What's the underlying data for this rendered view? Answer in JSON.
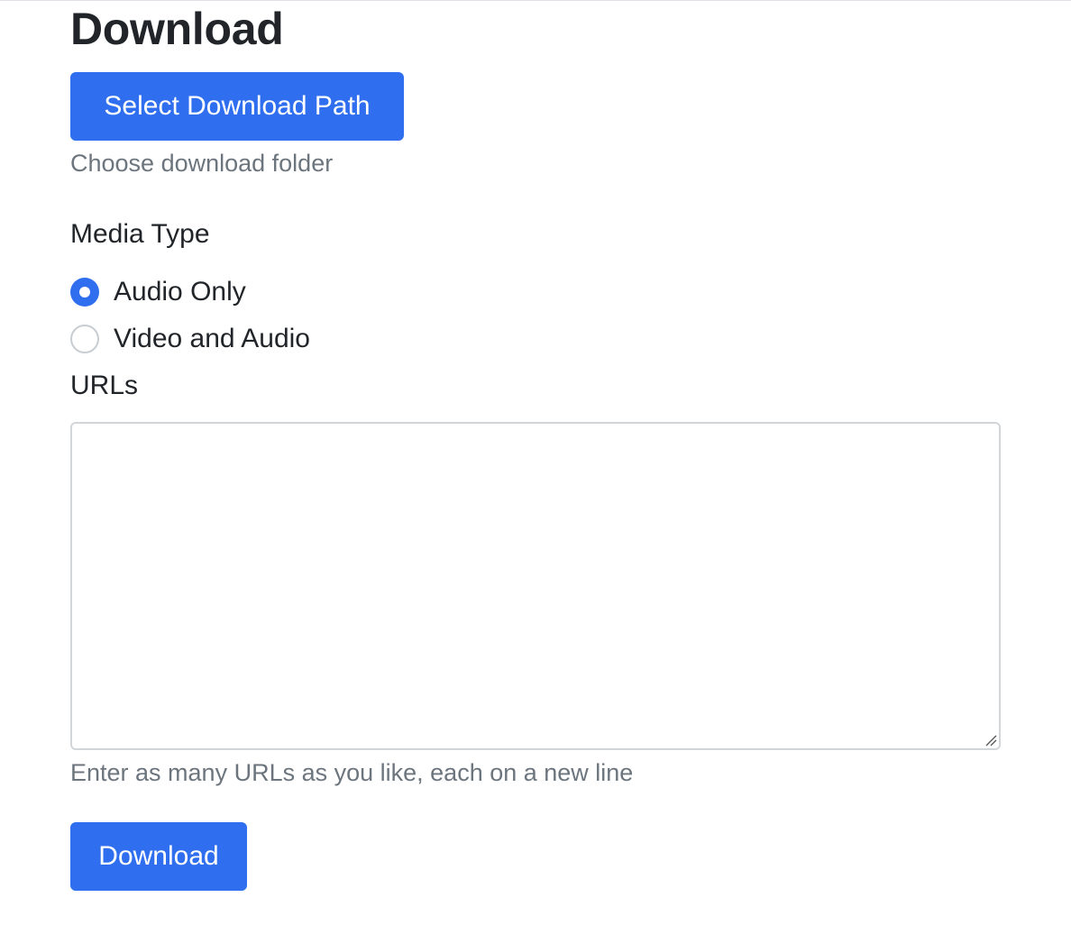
{
  "heading": "Download",
  "path_section": {
    "button_label": "Select Download Path",
    "help_text": "Choose download folder"
  },
  "media_type": {
    "label": "Media Type",
    "options": [
      {
        "label": "Audio Only",
        "checked": true
      },
      {
        "label": "Video and Audio",
        "checked": false
      }
    ]
  },
  "urls": {
    "label": "URLs",
    "value": "",
    "help_text": "Enter as many URLs as you like, each on a new line"
  },
  "submit": {
    "label": "Download"
  },
  "colors": {
    "primary": "#2f6fef",
    "text": "#212529",
    "muted": "#6c757d",
    "border": "#d3d6d9"
  },
  "icons": {
    "resize": "resize-grip-icon"
  }
}
